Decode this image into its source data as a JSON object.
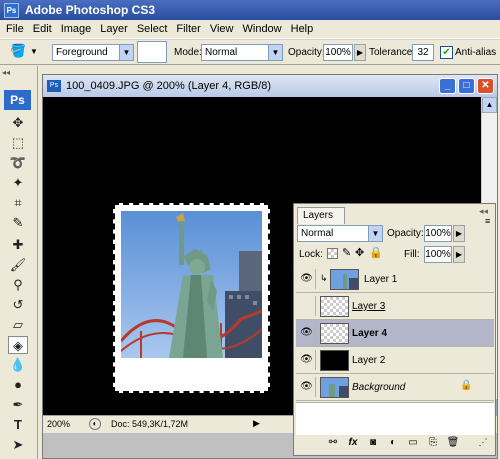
{
  "app": {
    "title": "Adobe Photoshop CS3",
    "logo": "Ps"
  },
  "menu": [
    "File",
    "Edit",
    "Image",
    "Layer",
    "Select",
    "Filter",
    "View",
    "Window",
    "Help"
  ],
  "options": {
    "fill_source": "Foreground",
    "mode_label": "Mode:",
    "mode_value": "Normal",
    "opacity_label": "Opacity:",
    "opacity_value": "100%",
    "tolerance_label": "Tolerance:",
    "tolerance_value": "32",
    "antialias_label": "Anti-alias",
    "antialias_checked": true
  },
  "document": {
    "title": "100_0409.JPG @ 200% (Layer 4, RGB/8)",
    "zoom": "200%",
    "doc_info": "Doc: 549,3K/1,72M"
  },
  "layers_panel": {
    "tab_label": "Layers",
    "blend_mode": "Normal",
    "opacity_label": "Opacity:",
    "opacity_value": "100%",
    "lock_label": "Lock:",
    "fill_label": "Fill:",
    "fill_value": "100%",
    "layers": [
      {
        "name": "Layer 1",
        "visible": true,
        "clipped": true,
        "thumb": "photo"
      },
      {
        "name": "Layer 3",
        "visible": false,
        "thumb": "checker"
      },
      {
        "name": "Layer 4",
        "visible": true,
        "selected": true,
        "thumb": "checker"
      },
      {
        "name": "Layer 2",
        "visible": true,
        "thumb": "black"
      },
      {
        "name": "Background",
        "visible": true,
        "locked": true,
        "thumb": "photo"
      }
    ]
  },
  "colors": {
    "titlebar": "#2a4c9c",
    "selected_layer": "#b3b6c9",
    "canvas_bg": "#000000"
  }
}
